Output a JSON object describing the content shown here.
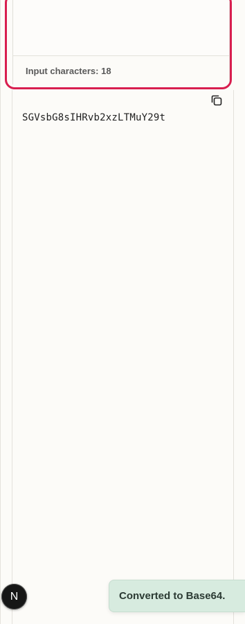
{
  "input": {
    "char_count_label": "Input characters: 18"
  },
  "output": {
    "value": "SGVsbG8sIHRvb2xzLTMuY29t"
  },
  "framework_badge": {
    "letter": "N"
  },
  "toast": {
    "message": "Converted to Base64."
  },
  "colors": {
    "focus_border": "#d81e4f",
    "toast_bg": "#d7ebdf",
    "page_bg": "#fcfbf8"
  },
  "icons": {
    "copy": "copy-icon"
  }
}
